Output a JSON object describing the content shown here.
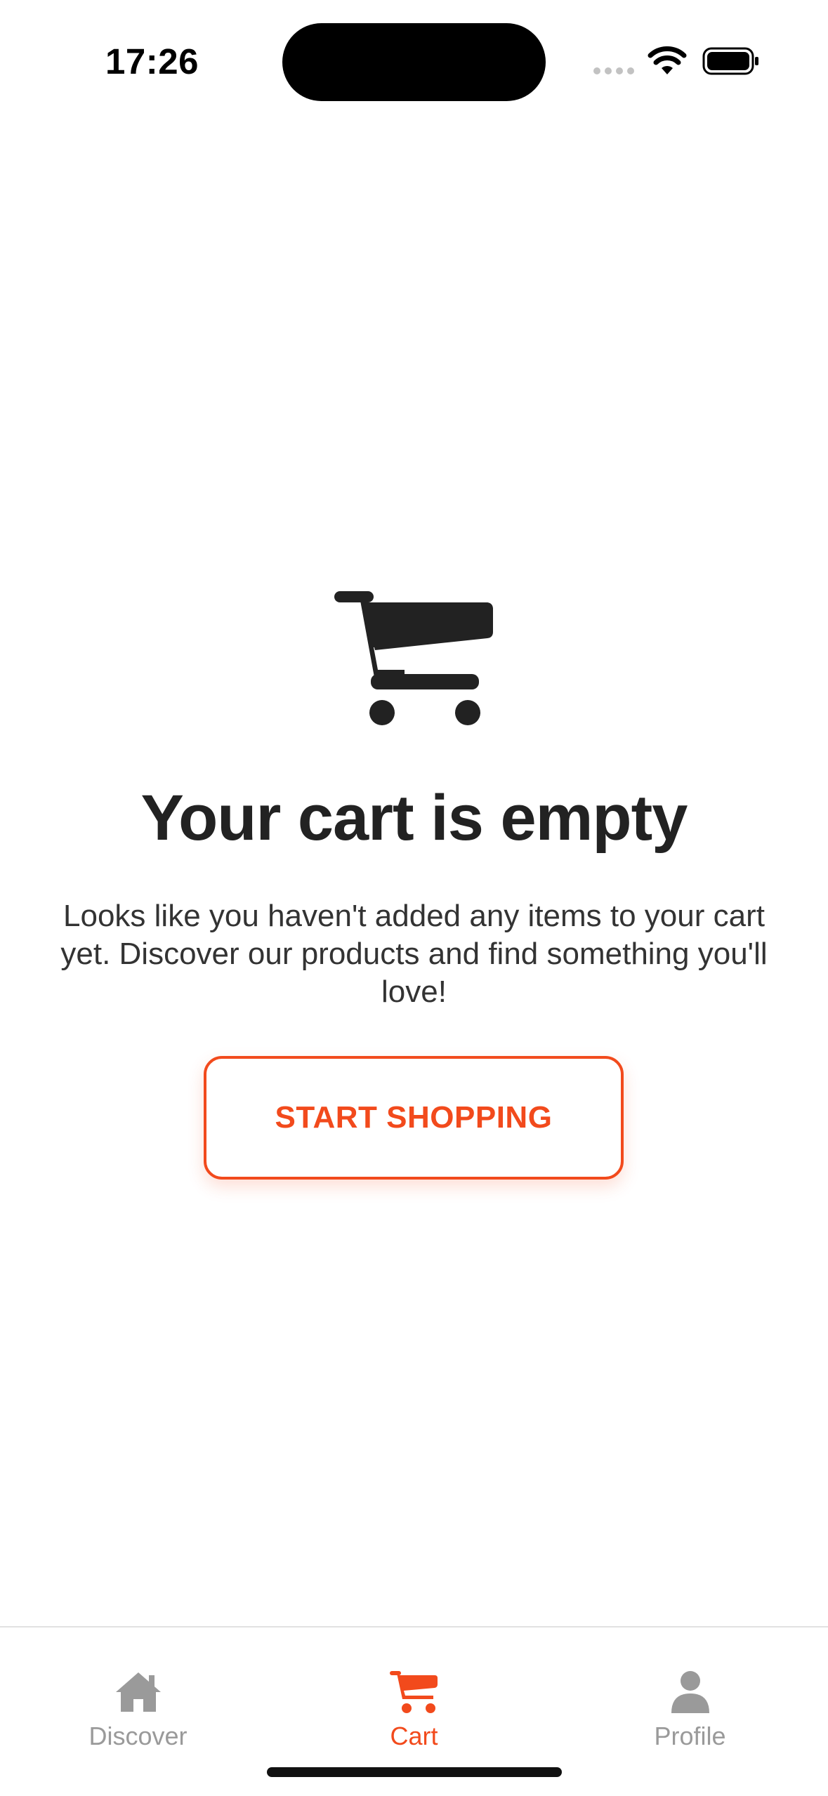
{
  "status_bar": {
    "time": "17:26"
  },
  "empty_state": {
    "icon": "shopping-cart-icon",
    "title": "Your cart is empty",
    "description": "Looks like you haven't added any items to your cart yet. Discover our products and find something you'll love!",
    "button_label": "START SHOPPING"
  },
  "tab_bar": {
    "tabs": [
      {
        "label": "Discover",
        "icon": "home-icon",
        "active": false
      },
      {
        "label": "Cart",
        "icon": "cart-icon",
        "active": true
      },
      {
        "label": "Profile",
        "icon": "person-icon",
        "active": false
      }
    ]
  },
  "colors": {
    "accent": "#f24a1c",
    "text_primary": "#222222",
    "text_secondary": "#333333",
    "tab_inactive": "#9a9a9a"
  }
}
